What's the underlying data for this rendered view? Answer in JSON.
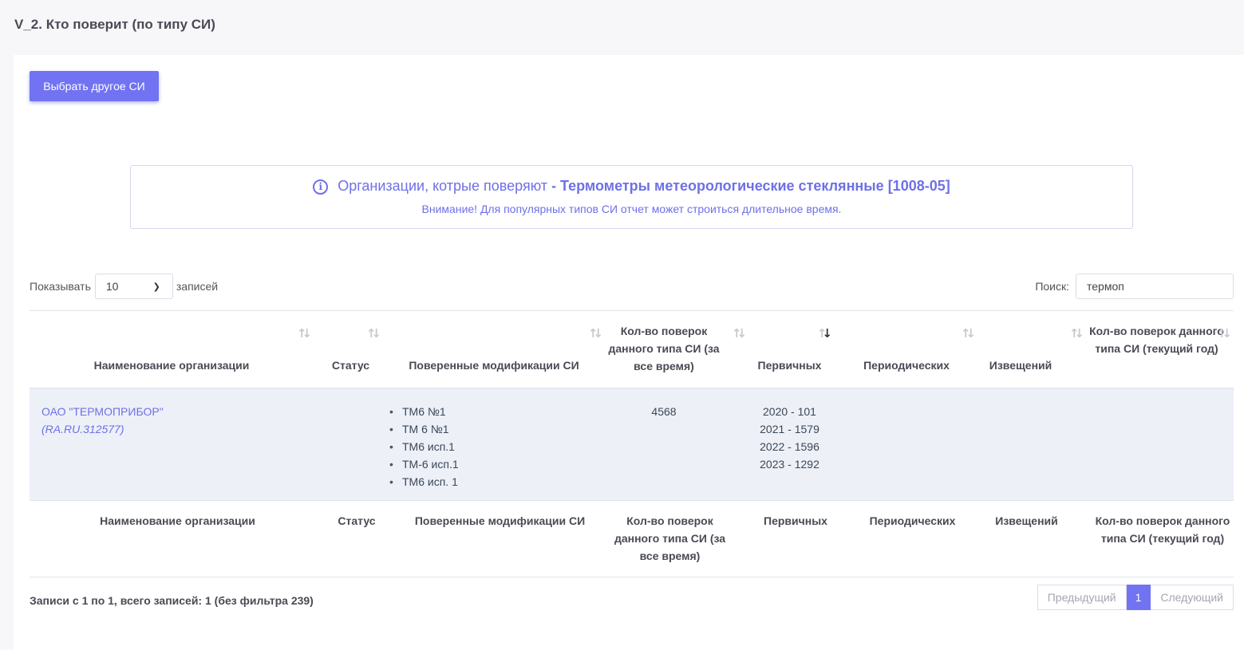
{
  "page_title": "V_2. Кто поверит (по типу СИ)",
  "choose_button": "Выбрать другое СИ",
  "alert": {
    "prefix": "Организации, котрые поверяют",
    "highlight": "- Термометры метеорологические стеклянные [1008-05]",
    "note": "Внимание! Для популярных типов СИ отчет может строиться длительное время."
  },
  "length_control": {
    "label_before": "Показывать",
    "value": "10",
    "label_after": "записей"
  },
  "search": {
    "label": "Поиск:",
    "value": "термоп"
  },
  "table": {
    "columns": [
      "Наименование организации",
      "Статус",
      "Поверенные модификации СИ",
      "Кол-во поверок данного типа СИ (за все время)",
      "Первичных",
      "Периодических",
      "Извещений",
      "Кол-во поверок данного типа СИ (текущий год)"
    ],
    "rows": [
      {
        "org_name": "ОАО \"ТЕРМОПРИБОР\"",
        "org_code": "(RA.RU.312577)",
        "status": "",
        "modifications": [
          "ТМ6 №1",
          "ТМ 6 №1",
          "ТМ6 исп.1",
          "ТМ-6 исп.1",
          "ТМ6 исп. 1"
        ],
        "total": "4568",
        "primary": [
          "2020 - 101",
          "2021 - 1579",
          "2022 - 1596",
          "2023 - 1292"
        ],
        "periodic": "",
        "notices": "",
        "current_year": ""
      }
    ]
  },
  "info_text": "Записи с 1 по 1, всего записей: 1 (без фильтра 239)",
  "pagination": {
    "prev": "Предыдущий",
    "current": "1",
    "next": "Следующий"
  }
}
